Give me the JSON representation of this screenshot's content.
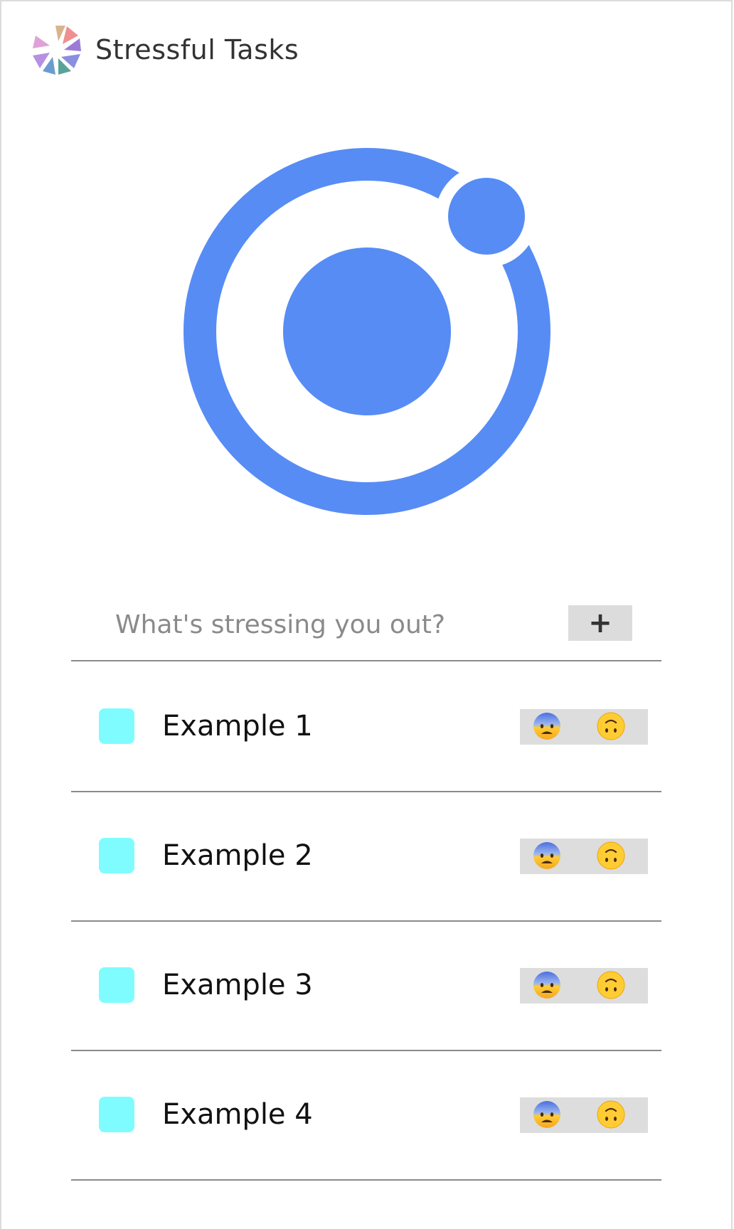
{
  "header": {
    "title": "Stressful Tasks",
    "logo_icon": "aperture-logo-icon"
  },
  "hero": {
    "icon": "ionic-logo-icon",
    "color": "#578CF5"
  },
  "add_task": {
    "placeholder": "What's stressing you out?",
    "value": "",
    "button_label": "+"
  },
  "tasks": [
    {
      "label": "Example 1",
      "stress_icon": "anxious-face-icon",
      "relief_icon": "upside-down-face-icon"
    },
    {
      "label": "Example 2",
      "stress_icon": "anxious-face-icon",
      "relief_icon": "upside-down-face-icon"
    },
    {
      "label": "Example 3",
      "stress_icon": "anxious-face-icon",
      "relief_icon": "upside-down-face-icon"
    },
    {
      "label": "Example 4",
      "stress_icon": "anxious-face-icon",
      "relief_icon": "upside-down-face-icon"
    }
  ],
  "colors": {
    "checkbox": "#7FFCFF",
    "emoji_bg": "#DDDDDD",
    "divider": "#8A8A8A"
  }
}
